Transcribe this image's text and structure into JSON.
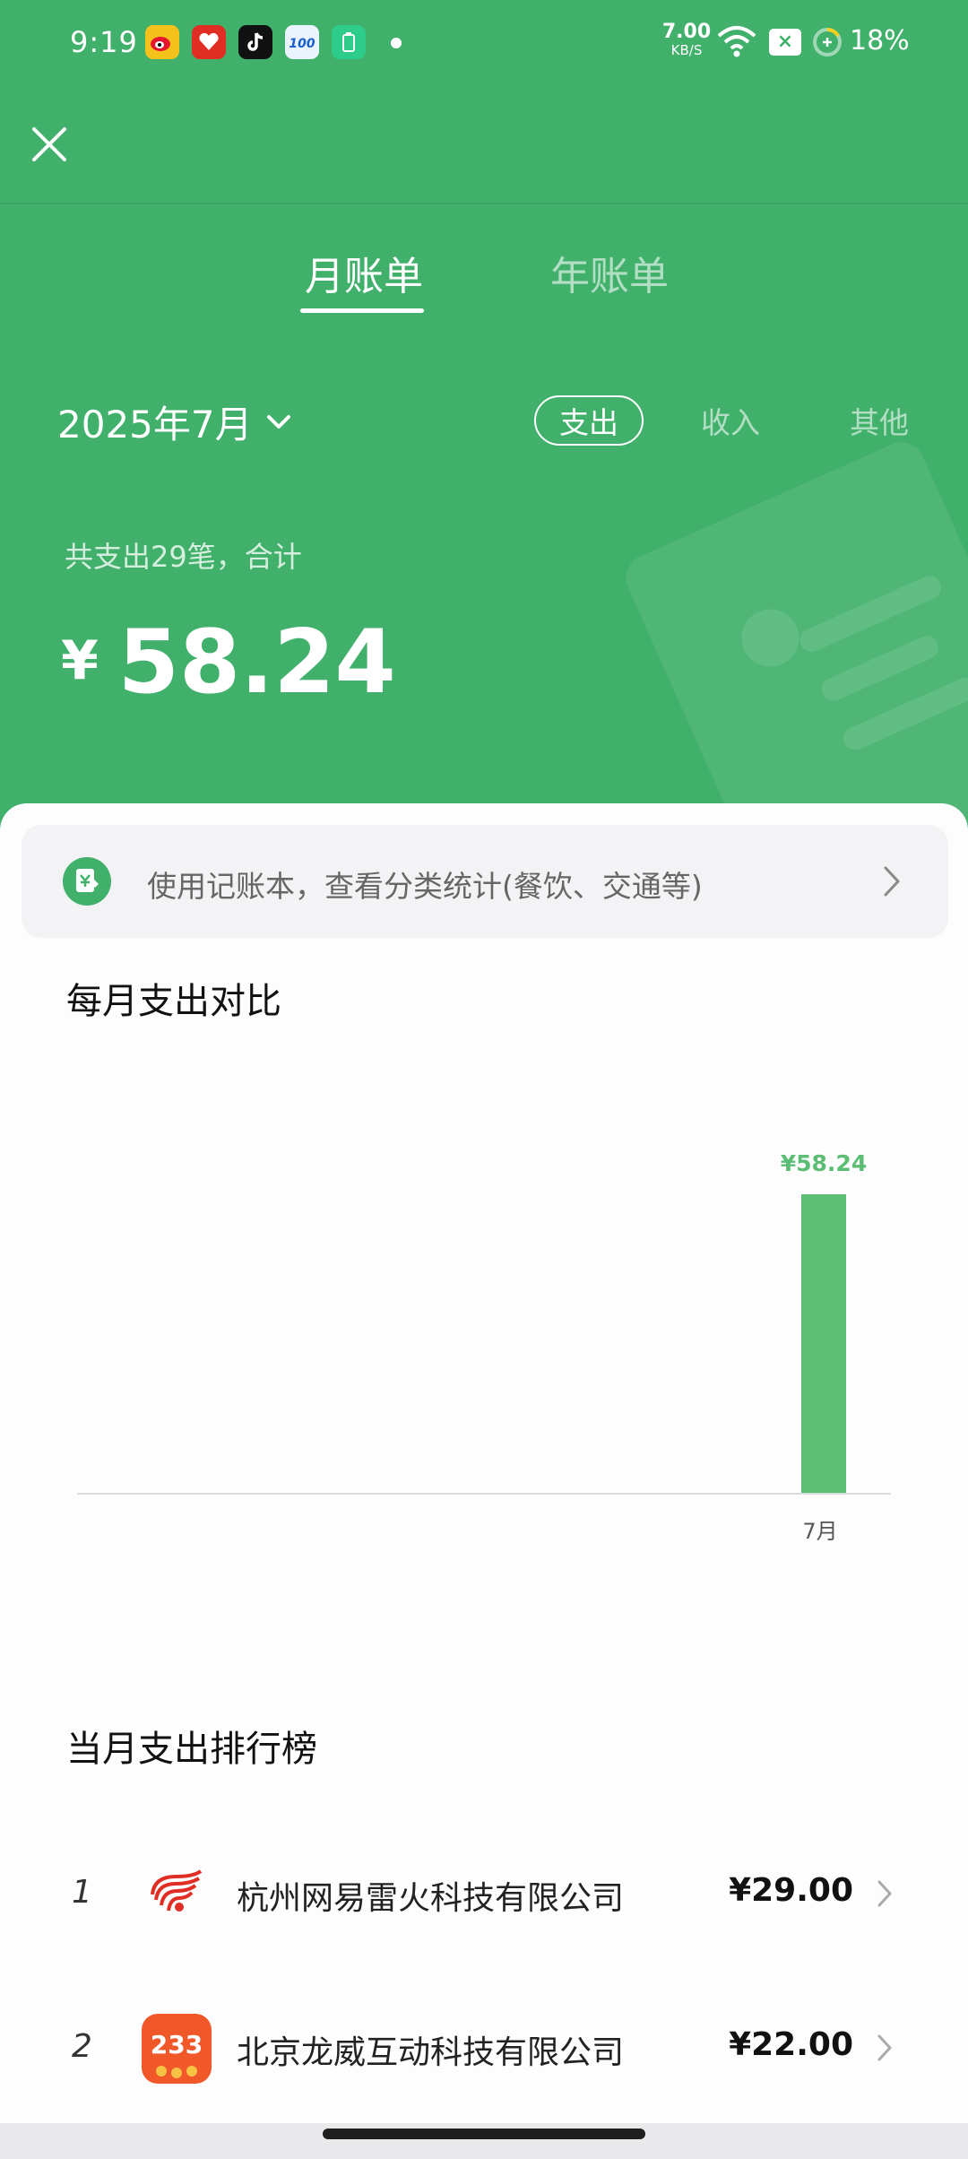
{
  "status_bar": {
    "time": "9:19",
    "speed_value": "7.00",
    "speed_unit": "KB/S",
    "battery_percent": "18%",
    "app_icons": [
      "weibo-icon",
      "pinduoduo-icon",
      "douyin-icon",
      "bank100-icon",
      "battery-app-icon"
    ]
  },
  "header": {
    "tabs": [
      {
        "label": "月账单",
        "active": true
      },
      {
        "label": "年账单",
        "active": false
      }
    ],
    "date_selector": "2025年7月",
    "type_filters": [
      {
        "label": "支出",
        "active": true
      },
      {
        "label": "收入",
        "active": false
      },
      {
        "label": "其他",
        "active": false
      }
    ],
    "summary_text": "共支出29笔，合计",
    "currency_symbol": "¥",
    "total_amount": "58.24"
  },
  "banner": {
    "text": "使用记账本，查看分类统计(餐饮、交通等)"
  },
  "monthly_chart": {
    "title": "每月支出对比"
  },
  "chart_data": {
    "type": "bar",
    "categories": [
      "7月"
    ],
    "values": [
      58.24
    ],
    "value_labels": [
      "¥58.24"
    ],
    "title": "每月支出对比",
    "xlabel": "",
    "ylabel": "",
    "ylim": [
      0,
      58.24
    ],
    "grid": false
  },
  "ranking": {
    "title": "当月支出排行榜",
    "items": [
      {
        "rank": "1",
        "name": "杭州网易雷火科技有限公司",
        "amount": "¥29.00",
        "logo": "netease-logo"
      },
      {
        "rank": "2",
        "name": "北京龙威互动科技有限公司",
        "amount": "¥22.00",
        "logo": "233-logo",
        "logo_text": "233"
      }
    ]
  },
  "colors": {
    "primary_green": "#40b06b",
    "bar_green": "#5cbd74"
  }
}
